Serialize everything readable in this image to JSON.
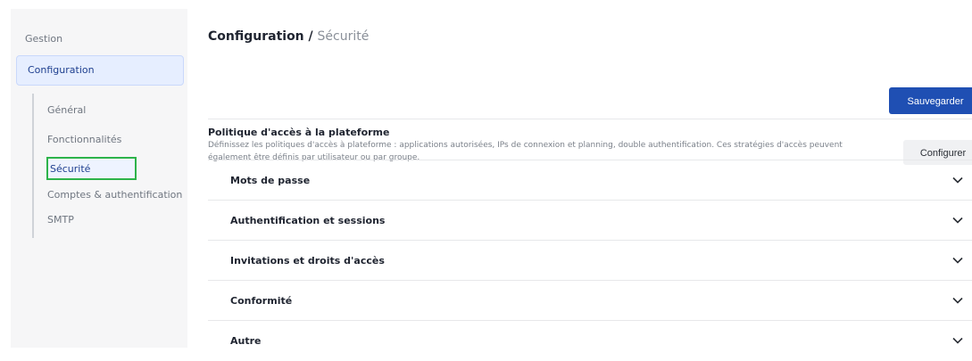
{
  "sidebar": {
    "gestion": "Gestion",
    "configuration": "Configuration",
    "sub_items": {
      "general": "Général",
      "fonctionnalites": "Fonctionnalités",
      "securite": "Sécurité",
      "comptes": "Comptes & authentification",
      "smtp": "SMTP"
    }
  },
  "header": {
    "breadcrumb_parent": "Configuration",
    "breadcrumb_separator": " / ",
    "breadcrumb_current": "Sécurité",
    "save_label": "Sauvegarder"
  },
  "policy": {
    "title": "Politique d'accès à la plateforme",
    "description": "Définissez les politiques d'accès à plateforme : applications autorisées, IPs de connexion et planning, double authentification. Ces stratégies d'accès peuvent également être définis par utilisateur ou par groupe.",
    "configure_label": "Configurer"
  },
  "sections": {
    "passwords": "Mots de passe",
    "auth_sessions": "Authentification et sessions",
    "invitations": "Invitations et droits d'accès",
    "compliance": "Conformité",
    "other": "Autre"
  },
  "icons": {
    "chevron": "chevron-down-icon"
  },
  "colors": {
    "primary": "#1f4fb3",
    "highlight_border": "#2db34a",
    "active_bg": "#e6eeff"
  }
}
